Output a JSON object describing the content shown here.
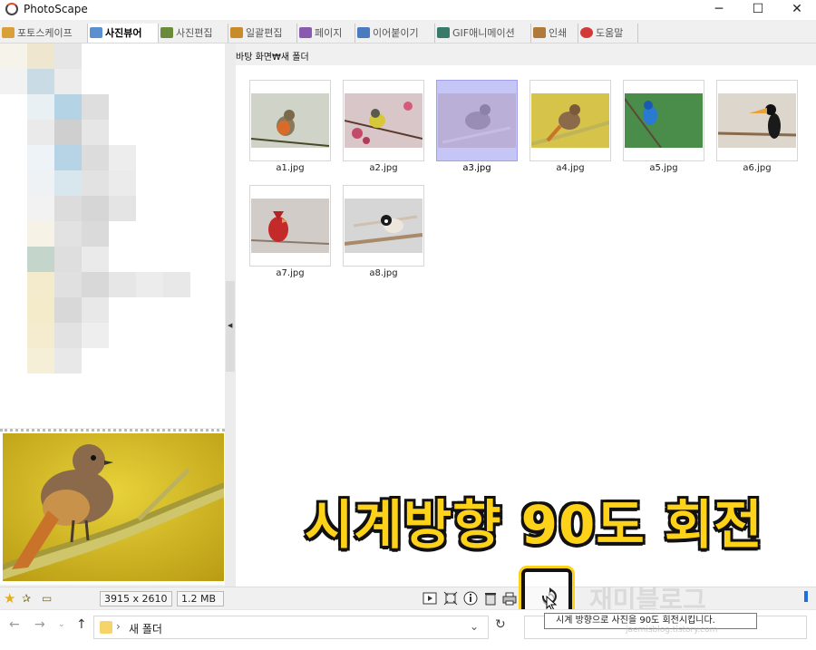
{
  "window": {
    "title": "PhotoScape",
    "minimize": "─",
    "maximize": "☐",
    "close": "✕"
  },
  "tabs": [
    {
      "label": "포토스케이프",
      "icon": "photoscape-tab-icon",
      "color": "#d9a03a"
    },
    {
      "label": "사진뷰어",
      "icon": "viewer-tab-icon",
      "color": "#5a8fd0",
      "active": true
    },
    {
      "label": "사진편집",
      "icon": "editor-tab-icon",
      "color": "#6a8c3a"
    },
    {
      "label": "일괄편집",
      "icon": "batch-tab-icon",
      "color": "#c98a2a"
    },
    {
      "label": "페이지",
      "icon": "page-tab-icon",
      "color": "#8a5ab0"
    },
    {
      "label": "이어붙이기",
      "icon": "combine-tab-icon",
      "color": "#4a7ac0"
    },
    {
      "label": "GIF애니메이션",
      "icon": "gif-tab-icon",
      "color": "#3a7a6a"
    },
    {
      "label": "인쇄",
      "icon": "print-tab-icon",
      "color": "#b07a3a"
    },
    {
      "label": "도움말",
      "icon": "help-tab-icon",
      "color": "#d23a3a"
    }
  ],
  "path": "바탕 화면₩새 폴더",
  "thumbnails": [
    {
      "name": "a1.jpg",
      "bird": "robin",
      "bg": "#cfd3c8"
    },
    {
      "name": "a2.jpg",
      "bird": "warbler",
      "bg": "#c9a8b4"
    },
    {
      "name": "a3.jpg",
      "bird": "sparrow",
      "bg": "#b9a8d4",
      "selected": true
    },
    {
      "name": "a4.jpg",
      "bird": "redstart",
      "bg": "#d8c24a"
    },
    {
      "name": "a5.jpg",
      "bird": "bluebird",
      "bg": "#4a8a4a"
    },
    {
      "name": "a6.jpg",
      "bird": "toucan",
      "bg": "#d9d2c8"
    },
    {
      "name": "a7.jpg",
      "bird": "cardinal",
      "bg": "#cfc9c5"
    },
    {
      "name": "a8.jpg",
      "bird": "chickadee",
      "bg": "#d4d4d4"
    }
  ],
  "status": {
    "dimensions": "3915 x 2610",
    "filesize": "1.2 MB"
  },
  "toolbar_icons": [
    "slideshow-icon",
    "fullscreen-icon",
    "info-icon",
    "delete-icon",
    "print-icon",
    "rotate-clockwise-icon"
  ],
  "caption": "시계방향 90도 회전",
  "tooltip": "시계 방향으로 사진을 90도 회전시킵니다.",
  "explorer": {
    "address": "새 폴더",
    "crumb": "›"
  },
  "watermark": "재미블로그",
  "watermark_url": "jaemisblog.tistory.com"
}
